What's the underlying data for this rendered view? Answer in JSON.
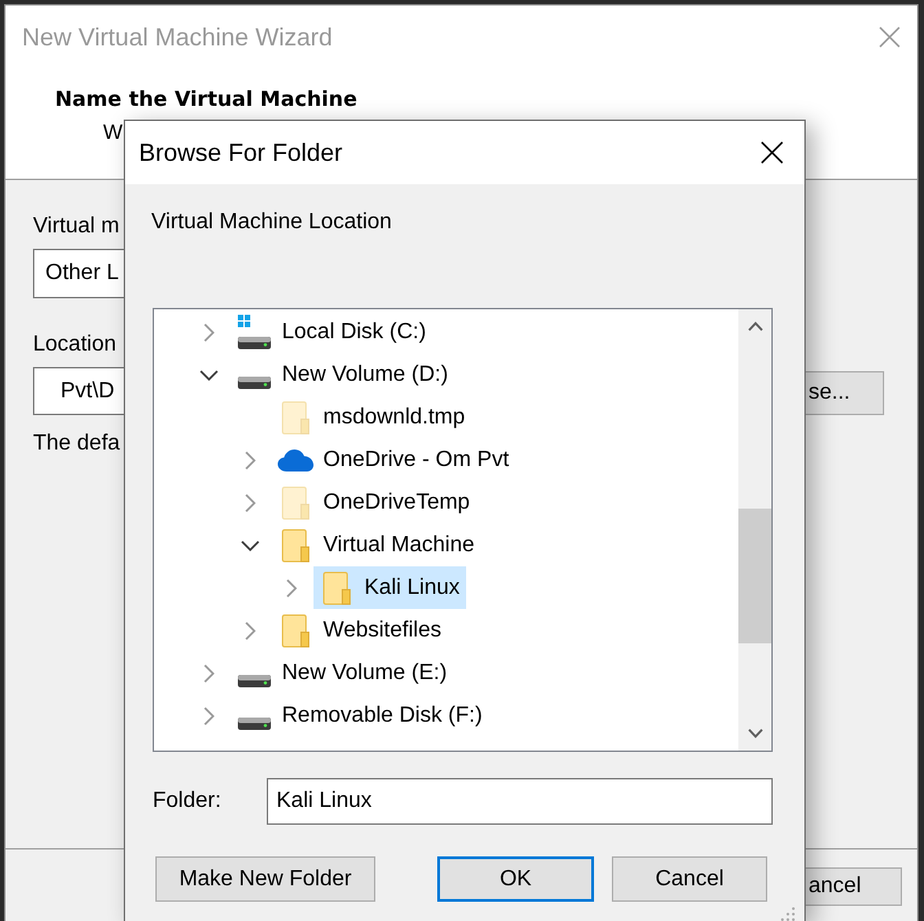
{
  "wizard": {
    "title": "New Virtual Machine Wizard",
    "heading": "Name the Virtual Machine",
    "subtitle": "W",
    "fields": [
      {
        "label": "Virtual m",
        "value": "Other L"
      },
      {
        "label": "Location",
        "value": "Pvt\\D"
      }
    ],
    "browse_button": "se...",
    "note": "The defa",
    "cancel_button": "ancel"
  },
  "dialog": {
    "title": "Browse For Folder",
    "prompt": "Virtual Machine Location",
    "tree": [
      {
        "label": "Local Disk (C:)",
        "kind": "system-drive",
        "expandable": true,
        "expanded": false,
        "hidden": false,
        "selected": false
      },
      {
        "label": "New Volume (D:)",
        "kind": "drive",
        "expandable": true,
        "expanded": true,
        "hidden": false,
        "selected": false,
        "children": [
          {
            "label": "msdownld.tmp",
            "kind": "folder",
            "expandable": false,
            "expanded": false,
            "hidden": true,
            "selected": false
          },
          {
            "label": "OneDrive - Om Pvt",
            "kind": "cloud",
            "expandable": true,
            "expanded": false,
            "hidden": false,
            "selected": false
          },
          {
            "label": "OneDriveTemp",
            "kind": "folder",
            "expandable": true,
            "expanded": false,
            "hidden": true,
            "selected": false
          },
          {
            "label": "Virtual Machine",
            "kind": "folder",
            "expandable": true,
            "expanded": true,
            "hidden": false,
            "selected": false,
            "children": [
              {
                "label": "Kali Linux",
                "kind": "folder",
                "expandable": true,
                "expanded": false,
                "hidden": false,
                "selected": true
              }
            ]
          },
          {
            "label": "Websitefiles",
            "kind": "folder",
            "expandable": true,
            "expanded": false,
            "hidden": false,
            "selected": false
          }
        ]
      },
      {
        "label": "New Volume (E:)",
        "kind": "drive",
        "expandable": true,
        "expanded": false,
        "hidden": false,
        "selected": false
      },
      {
        "label": "Removable Disk (F:)",
        "kind": "drive",
        "expandable": true,
        "expanded": false,
        "hidden": false,
        "selected": false
      }
    ],
    "folder_field": {
      "label": "Folder:",
      "value": "Kali Linux"
    },
    "buttons": [
      {
        "label": "Make New Folder",
        "default": false
      },
      {
        "label": "OK",
        "default": true
      },
      {
        "label": "Cancel",
        "default": false
      }
    ]
  }
}
